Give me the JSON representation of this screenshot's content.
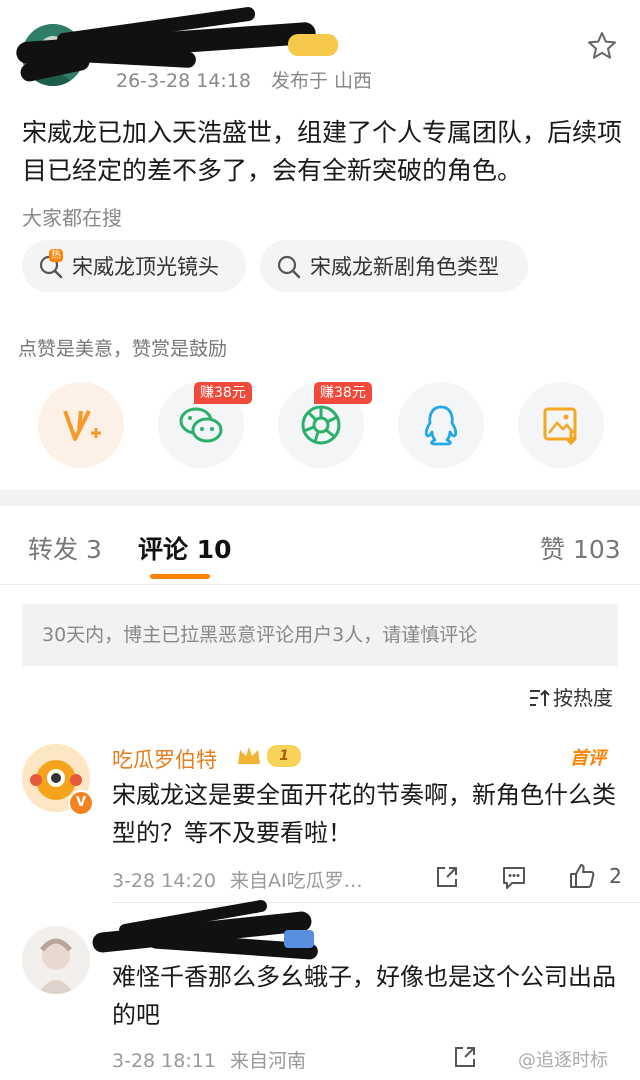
{
  "post": {
    "meta_time": "26-3-28 14:18",
    "meta_location": "发布于 山西",
    "text": "宋威龙已加入天浩盛世，组建了个人专属团队，后续项目已经定的差不多了，会有全新突破的角色。"
  },
  "search": {
    "label": "大家都在搜",
    "chips": [
      "宋威龙顶光镜头",
      "宋威龙新剧角色类型"
    ],
    "hot_tag": "热"
  },
  "reward": {
    "label": "点赞是美意，赞赏是鼓励",
    "earn_badge_1": "赚38元",
    "earn_badge_2": "赚38元"
  },
  "tabs": {
    "repost": "转发 3",
    "comments": "评论 10",
    "likes": "赞 103"
  },
  "notice": "30天内，博主已拉黑恶意评论用户3人，请谨慎评论",
  "sort_label": "按热度",
  "comments": [
    {
      "name": "吃瓜罗伯特",
      "level": "1",
      "first_badge": "首评",
      "text": "宋威龙这是要全面开花的节奏啊，新角色什么类型的？等不及要看啦！",
      "time": "3-28 14:20",
      "source": "来自AI吃瓜罗…",
      "likes": "2"
    },
    {
      "text": "难怪千香那么多幺蛾子，好像也是这个公司出品的吧",
      "time": "3-28 18:11",
      "source": "来自河南"
    }
  ],
  "watermark": "@追逐时标",
  "colors": {
    "accent": "#ff8200",
    "earn_badge": "#f24a3a"
  }
}
